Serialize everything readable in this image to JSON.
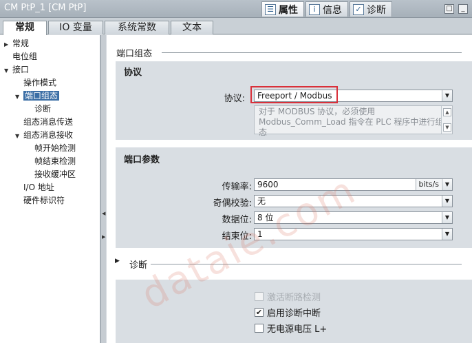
{
  "window": {
    "title": "CM PtP_1 [CM PtP]"
  },
  "inspector_tabs": [
    {
      "label": "属性",
      "icon": "properties-icon"
    },
    {
      "label": "信息",
      "icon": "info-icon"
    },
    {
      "label": "诊断",
      "icon": "diagnostics-icon"
    }
  ],
  "section_tabs": [
    "常规",
    "IO 变量",
    "系统常数",
    "文本"
  ],
  "nav": [
    {
      "label": "常规",
      "arrow": "▶"
    },
    {
      "label": "电位组",
      "arrow": ""
    },
    {
      "label": "接口",
      "arrow": "▼"
    },
    {
      "label": "操作模式",
      "arrow": ""
    },
    {
      "label": "端口组态",
      "arrow": "▼"
    },
    {
      "label": "诊断",
      "arrow": ""
    },
    {
      "label": "组态消息传送",
      "arrow": ""
    },
    {
      "label": "组态消息接收",
      "arrow": "▼"
    },
    {
      "label": "帧开始检测",
      "arrow": ""
    },
    {
      "label": "帧结束检测",
      "arrow": ""
    },
    {
      "label": "接收缓冲区",
      "arrow": ""
    },
    {
      "label": "I/O 地址",
      "arrow": ""
    },
    {
      "label": "硬件标识符",
      "arrow": ""
    }
  ],
  "content": {
    "heading": "端口组态",
    "protocol_panel": {
      "title": "协议",
      "protocol_label": "协议:",
      "protocol_value": "Freeport / Modbus",
      "description_line1": "对于 MODBUS 协议，必须使用",
      "description_line2": "Modbus_Comm_Load 指令在 PLC 程序中进行组态"
    },
    "port_panel": {
      "title": "端口参数",
      "baud_label": "传输率:",
      "baud_value": "9600",
      "baud_unit": "bits/s",
      "parity_label": "奇偶校验:",
      "parity_value": "无",
      "data_bits_label": "数据位:",
      "data_bits_value": "8 位",
      "stop_bits_label": "结束位:",
      "stop_bits_value": "1"
    },
    "diag_heading": "诊断",
    "diag_options": [
      {
        "label": "激活断路检测",
        "checked": false,
        "disabled": true
      },
      {
        "label": "启用诊断中断",
        "checked": true,
        "disabled": false
      },
      {
        "label": "无电源电压 L+",
        "checked": false,
        "disabled": false
      }
    ]
  },
  "watermark": "dataie.com"
}
